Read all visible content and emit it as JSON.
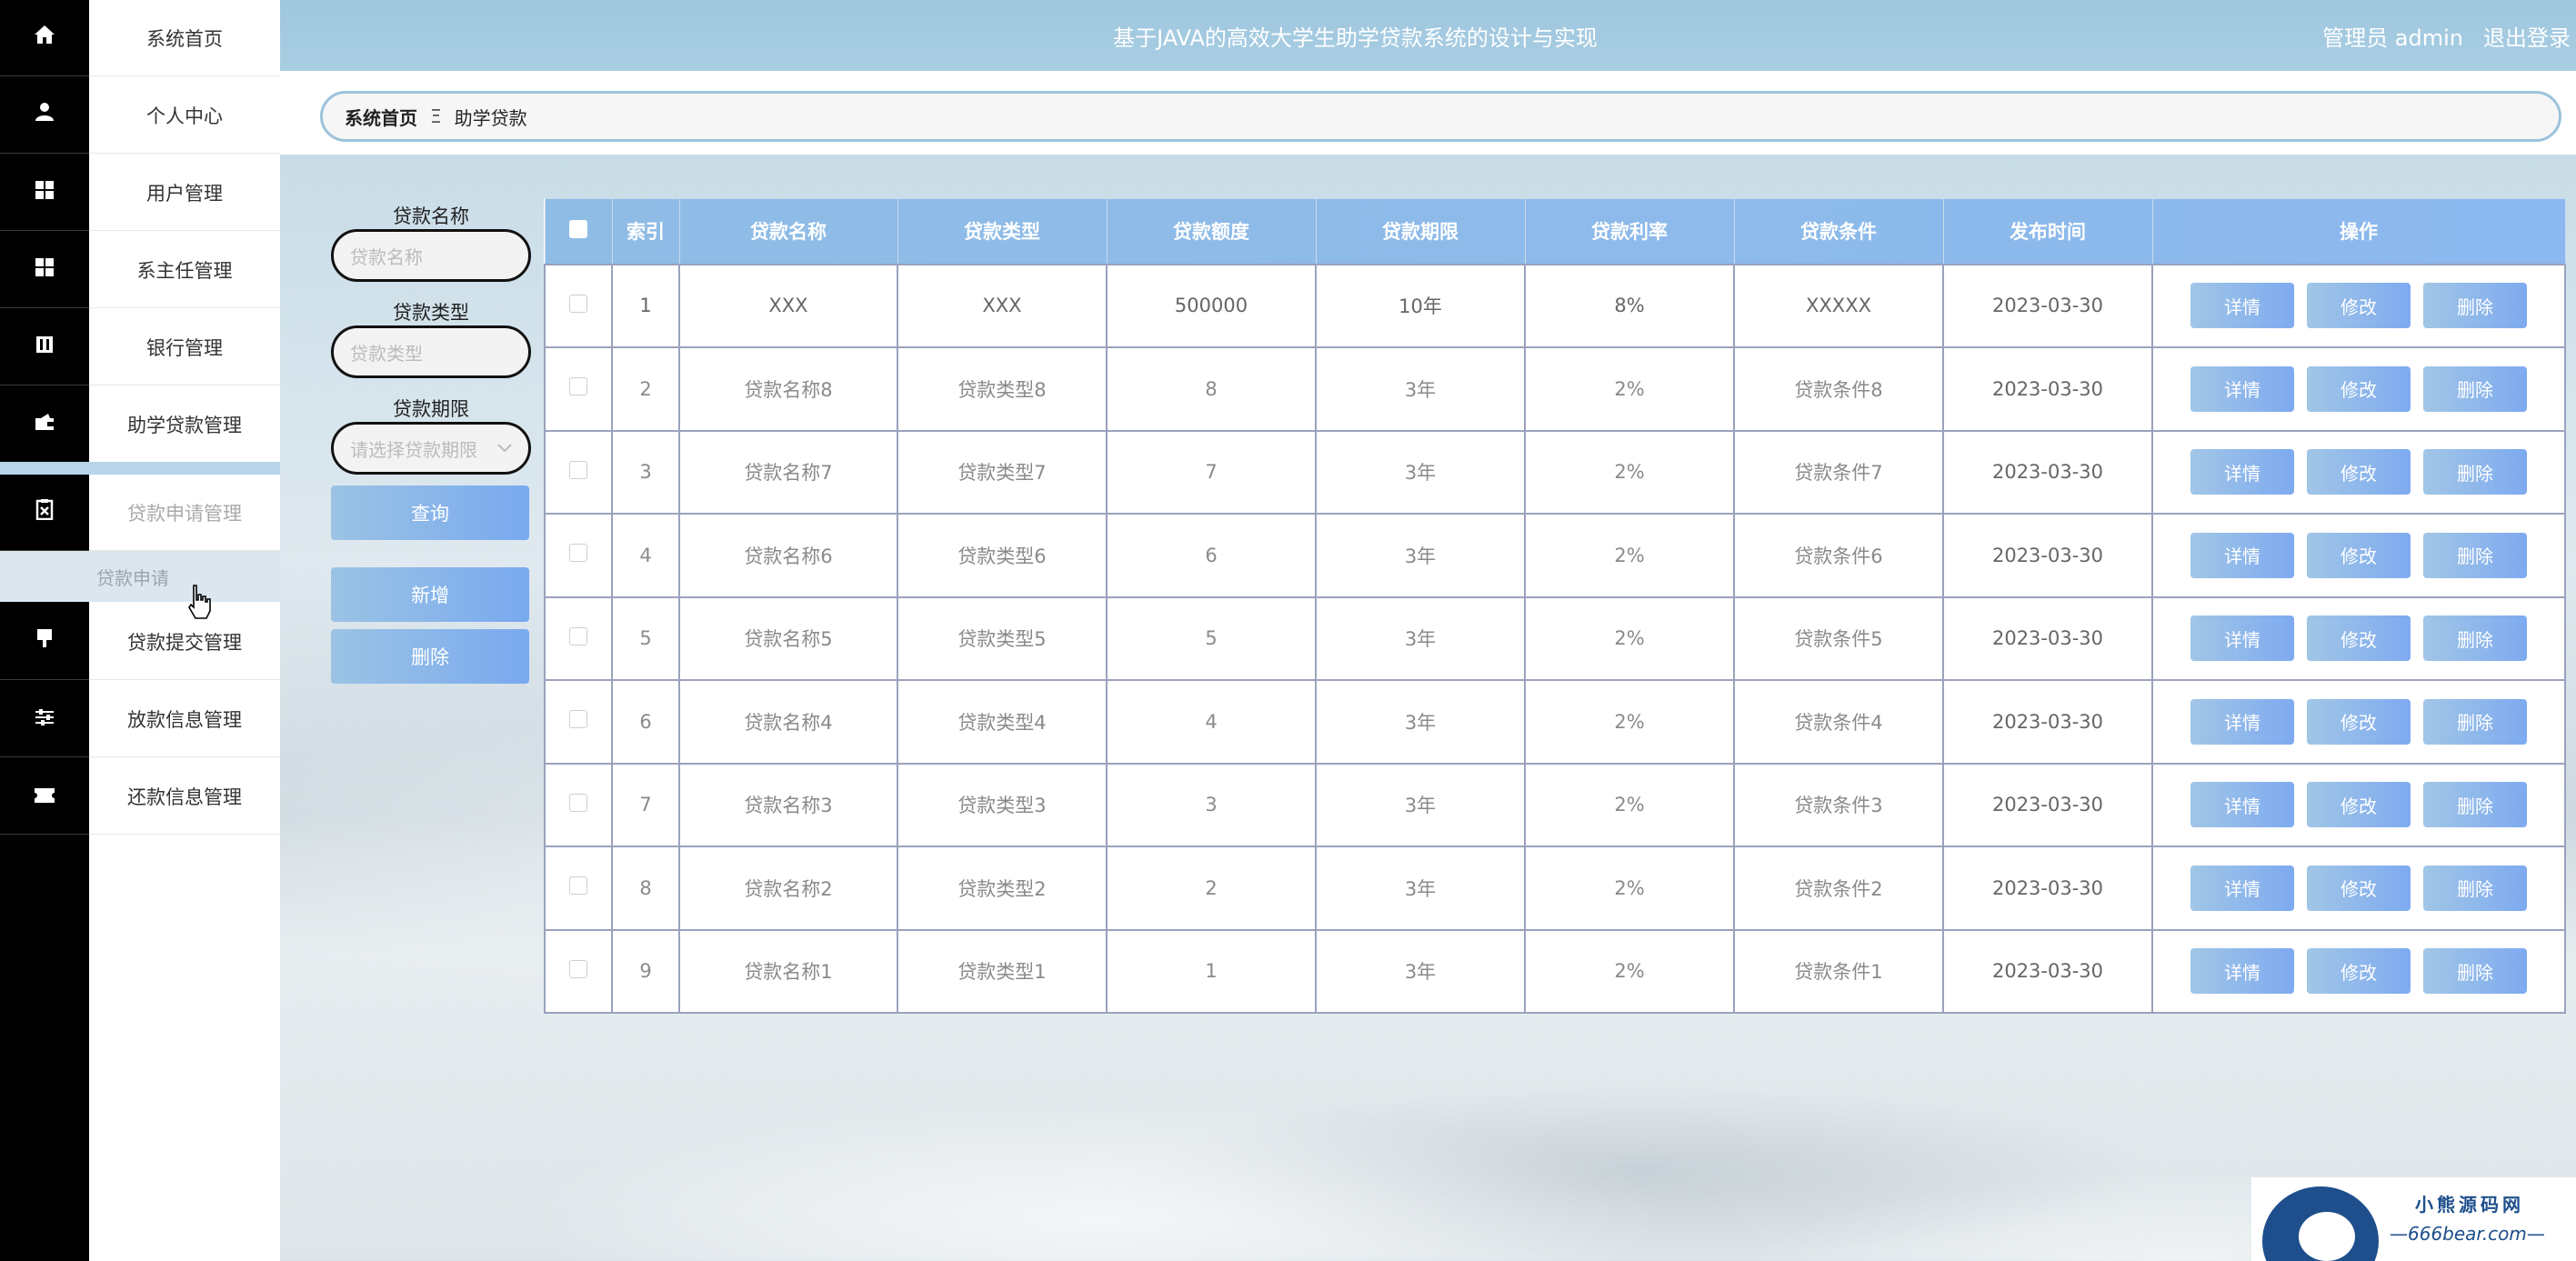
{
  "header": {
    "title": "基于JAVA的高效大学生助学贷款系统的设计与实现",
    "user": "管理员 admin",
    "logout": "退出登录"
  },
  "breadcrumb": {
    "home": "系统首页",
    "separator": "Ξ",
    "current": "助学贷款"
  },
  "sidebar": {
    "items": [
      {
        "label": "系统首页",
        "icon": "home-icon"
      },
      {
        "label": "个人中心",
        "icon": "user-icon"
      },
      {
        "label": "用户管理",
        "icon": "grid-icon"
      },
      {
        "label": "系主任管理",
        "icon": "grid-icon"
      },
      {
        "label": "银行管理",
        "icon": "bank-icon"
      },
      {
        "label": "助学贷款管理",
        "icon": "wallet-icon"
      },
      {
        "label": "贷款申请管理",
        "icon": "clipboard-icon"
      },
      {
        "label": "贷款提交管理",
        "icon": "submit-icon"
      },
      {
        "label": "放款信息管理",
        "icon": "sliders-icon"
      },
      {
        "label": "还款信息管理",
        "icon": "ticket-icon"
      }
    ],
    "submenu_item": "贷款申请"
  },
  "search": {
    "name_label": "贷款名称",
    "name_placeholder": "贷款名称",
    "type_label": "贷款类型",
    "type_placeholder": "贷款类型",
    "term_label": "贷款期限",
    "term_placeholder": "请选择贷款期限",
    "query_button": "查询",
    "add_button": "新增",
    "delete_button": "删除"
  },
  "table": {
    "headers": [
      "索引",
      "贷款名称",
      "贷款类型",
      "贷款额度",
      "贷款期限",
      "贷款利率",
      "贷款条件",
      "发布时间",
      "操作"
    ],
    "actions": {
      "detail": "详情",
      "edit": "修改",
      "delete": "删除"
    },
    "rows": [
      [
        "1",
        "XXX",
        "XXX",
        "500000",
        "10年",
        "8%",
        "XXXXX",
        "2023-03-30"
      ],
      [
        "2",
        "贷款名称8",
        "贷款类型8",
        "8",
        "3年",
        "2%",
        "贷款条件8",
        "2023-03-30"
      ],
      [
        "3",
        "贷款名称7",
        "贷款类型7",
        "7",
        "3年",
        "2%",
        "贷款条件7",
        "2023-03-30"
      ],
      [
        "4",
        "贷款名称6",
        "贷款类型6",
        "6",
        "3年",
        "2%",
        "贷款条件6",
        "2023-03-30"
      ],
      [
        "5",
        "贷款名称5",
        "贷款类型5",
        "5",
        "3年",
        "2%",
        "贷款条件5",
        "2023-03-30"
      ],
      [
        "6",
        "贷款名称4",
        "贷款类型4",
        "4",
        "3年",
        "2%",
        "贷款条件4",
        "2023-03-30"
      ],
      [
        "7",
        "贷款名称3",
        "贷款类型3",
        "3",
        "3年",
        "2%",
        "贷款条件3",
        "2023-03-30"
      ],
      [
        "8",
        "贷款名称2",
        "贷款类型2",
        "2",
        "3年",
        "2%",
        "贷款条件2",
        "2023-03-30"
      ],
      [
        "9",
        "贷款名称1",
        "贷款类型1",
        "1",
        "3年",
        "2%",
        "贷款条件1",
        "2023-03-30"
      ]
    ]
  },
  "watermark": {
    "brand": "小熊源码网",
    "site": "—666bear.com—"
  }
}
